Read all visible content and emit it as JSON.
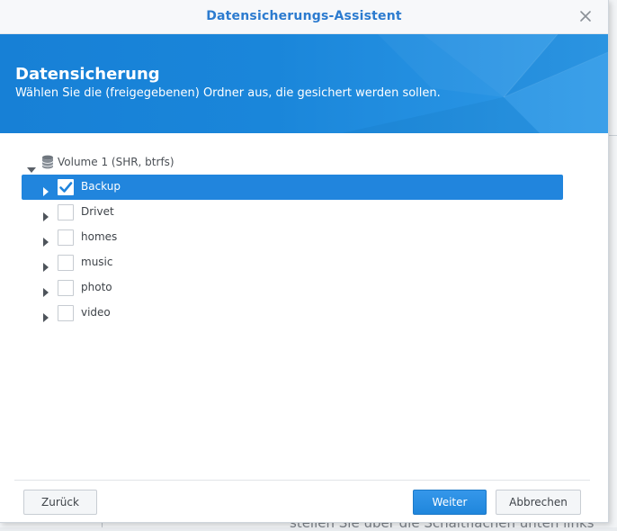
{
  "window": {
    "title": "Datensicherungs-Assistent",
    "close_icon": "close-icon"
  },
  "banner": {
    "title": "Datensicherung",
    "subtitle": "Wählen Sie die (freigegebenen) Ordner aus, die gesichert werden sollen."
  },
  "tree": {
    "root": {
      "label": "Volume 1 (SHR, btrfs)",
      "icon": "database-icon",
      "expanded": true
    },
    "items": [
      {
        "label": "Backup",
        "checked": true,
        "selected": true
      },
      {
        "label": "Drivet",
        "checked": false,
        "selected": false
      },
      {
        "label": "homes",
        "checked": false,
        "selected": false
      },
      {
        "label": "music",
        "checked": false,
        "selected": false
      },
      {
        "label": "photo",
        "checked": false,
        "selected": false
      },
      {
        "label": "video",
        "checked": false,
        "selected": false
      }
    ]
  },
  "footer": {
    "back_label": "Zurück",
    "next_label": "Weiter",
    "cancel_label": "Abbrechen"
  },
  "background": {
    "partial_text": "stellen Sie über die Schaltflächen unten links"
  },
  "colors": {
    "accent": "#2185dd",
    "title_text": "#2c7bcf",
    "banner": "#1a86da"
  }
}
